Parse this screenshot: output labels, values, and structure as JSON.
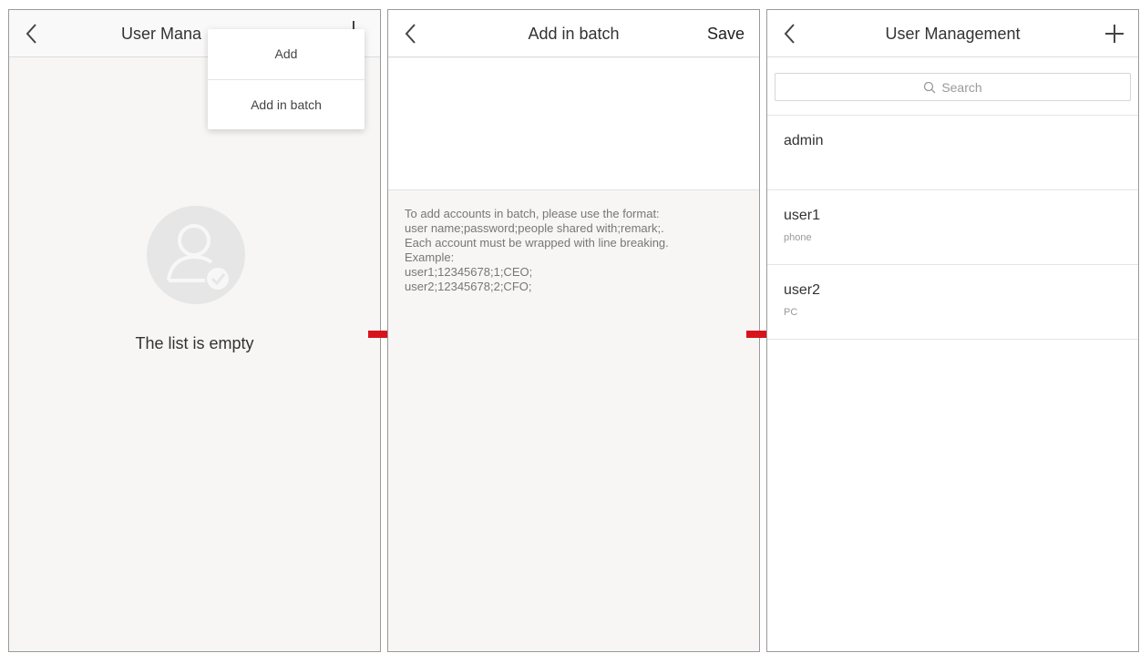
{
  "screen1": {
    "title": "User Mana",
    "dropdown": {
      "add": "Add",
      "add_batch": "Add in batch"
    },
    "empty_text": "The list is empty"
  },
  "screen2": {
    "title": "Add in batch",
    "save_label": "Save",
    "help_lines": [
      "To add accounts in batch, please use the format:",
      "user name;password;people shared with;remark;.",
      "Each account must be wrapped with line breaking.",
      "Example:",
      "user1;12345678;1;CEO;",
      "user2;12345678;2;CFO;"
    ]
  },
  "screen3": {
    "title": "User Management",
    "search_placeholder": "Search",
    "users": [
      {
        "name": "admin",
        "sub": ""
      },
      {
        "name": "user1",
        "sub": "phone"
      },
      {
        "name": "user2",
        "sub": "PC"
      }
    ]
  },
  "colors": {
    "arrow": "#d7141b",
    "avatar_bg": "#e6e6e6",
    "avatar_fg": "#f7f7f7"
  }
}
